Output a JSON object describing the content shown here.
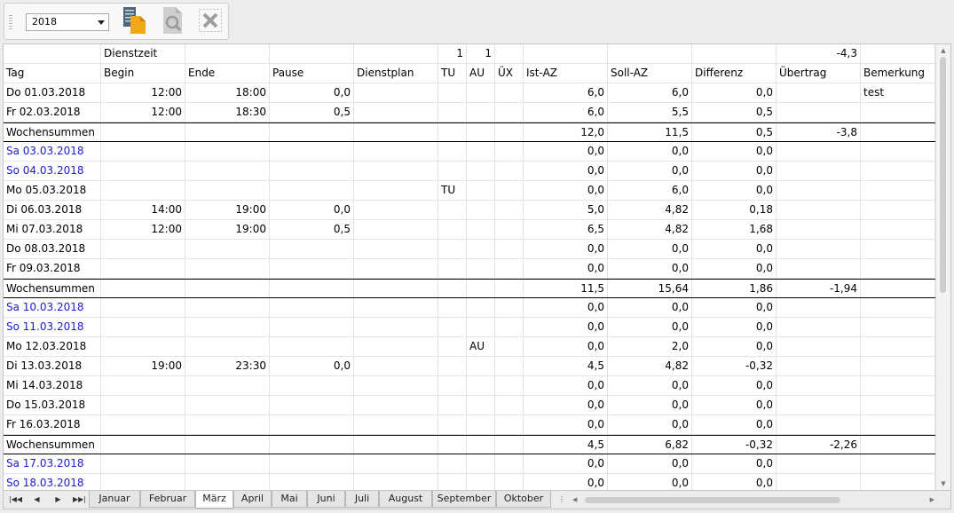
{
  "toolbar": {
    "year": "2018",
    "icons": [
      "copy-icon",
      "preview-icon",
      "delete-icon"
    ]
  },
  "grid": {
    "summary_row": {
      "label": "Dienstzeit",
      "tu": "1",
      "au": "1",
      "uebertrag": "-4,3"
    },
    "headers": [
      "Tag",
      "Begin",
      "Ende",
      "Pause",
      "Dienstplan",
      "TU",
      "AU",
      "ÜX",
      "Ist-AZ",
      "Soll-AZ",
      "Differenz",
      "Übertrag",
      "Bemerkung"
    ],
    "rows": [
      {
        "tag": "Do 01.03.2018",
        "begin": "12:00",
        "ende": "18:00",
        "pause": "0,0",
        "dienstplan": "",
        "tu": "",
        "au": "",
        "ux": "",
        "ist": "6,0",
        "soll": "6,0",
        "diff": "0,0",
        "uebertrag": "",
        "bemerkung": "test",
        "weekend": false,
        "weeksum": false
      },
      {
        "tag": "Fr 02.03.2018",
        "begin": "12:00",
        "ende": "18:30",
        "pause": "0,5",
        "dienstplan": "",
        "tu": "",
        "au": "",
        "ux": "",
        "ist": "6,0",
        "soll": "5,5",
        "diff": "0,5",
        "uebertrag": "",
        "bemerkung": "",
        "weekend": false,
        "weeksum": false
      },
      {
        "tag": "Wochensummen",
        "begin": "",
        "ende": "",
        "pause": "",
        "dienstplan": "",
        "tu": "",
        "au": "",
        "ux": "",
        "ist": "12,0",
        "soll": "11,5",
        "diff": "0,5",
        "uebertrag": "-3,8",
        "bemerkung": "",
        "weekend": false,
        "weeksum": true
      },
      {
        "tag": "Sa 03.03.2018",
        "begin": "",
        "ende": "",
        "pause": "",
        "dienstplan": "",
        "tu": "",
        "au": "",
        "ux": "",
        "ist": "0,0",
        "soll": "0,0",
        "diff": "0,0",
        "uebertrag": "",
        "bemerkung": "",
        "weekend": true,
        "weeksum": false
      },
      {
        "tag": "So 04.03.2018",
        "begin": "",
        "ende": "",
        "pause": "",
        "dienstplan": "",
        "tu": "",
        "au": "",
        "ux": "",
        "ist": "0,0",
        "soll": "0,0",
        "diff": "0,0",
        "uebertrag": "",
        "bemerkung": "",
        "weekend": true,
        "weeksum": false
      },
      {
        "tag": "Mo 05.03.2018",
        "begin": "",
        "ende": "",
        "pause": "",
        "dienstplan": "",
        "tu": "TU",
        "au": "",
        "ux": "",
        "ist": "0,0",
        "soll": "6,0",
        "diff": "0,0",
        "uebertrag": "",
        "bemerkung": "",
        "weekend": false,
        "weeksum": false
      },
      {
        "tag": "Di 06.03.2018",
        "begin": "14:00",
        "ende": "19:00",
        "pause": "0,0",
        "dienstplan": "",
        "tu": "",
        "au": "",
        "ux": "",
        "ist": "5,0",
        "soll": "4,82",
        "diff": "0,18",
        "uebertrag": "",
        "bemerkung": "",
        "weekend": false,
        "weeksum": false
      },
      {
        "tag": "Mi 07.03.2018",
        "begin": "12:00",
        "ende": "19:00",
        "pause": "0,5",
        "dienstplan": "",
        "tu": "",
        "au": "",
        "ux": "",
        "ist": "6,5",
        "soll": "4,82",
        "diff": "1,68",
        "uebertrag": "",
        "bemerkung": "",
        "weekend": false,
        "weeksum": false
      },
      {
        "tag": "Do 08.03.2018",
        "begin": "",
        "ende": "",
        "pause": "",
        "dienstplan": "",
        "tu": "",
        "au": "",
        "ux": "",
        "ist": "0,0",
        "soll": "0,0",
        "diff": "0,0",
        "uebertrag": "",
        "bemerkung": "",
        "weekend": false,
        "weeksum": false
      },
      {
        "tag": "Fr 09.03.2018",
        "begin": "",
        "ende": "",
        "pause": "",
        "dienstplan": "",
        "tu": "",
        "au": "",
        "ux": "",
        "ist": "0,0",
        "soll": "0,0",
        "diff": "0,0",
        "uebertrag": "",
        "bemerkung": "",
        "weekend": false,
        "weeksum": false
      },
      {
        "tag": "Wochensummen",
        "begin": "",
        "ende": "",
        "pause": "",
        "dienstplan": "",
        "tu": "",
        "au": "",
        "ux": "",
        "ist": "11,5",
        "soll": "15,64",
        "diff": "1,86",
        "uebertrag": "-1,94",
        "bemerkung": "",
        "weekend": false,
        "weeksum": true
      },
      {
        "tag": "Sa 10.03.2018",
        "begin": "",
        "ende": "",
        "pause": "",
        "dienstplan": "",
        "tu": "",
        "au": "",
        "ux": "",
        "ist": "0,0",
        "soll": "0,0",
        "diff": "0,0",
        "uebertrag": "",
        "bemerkung": "",
        "weekend": true,
        "weeksum": false
      },
      {
        "tag": "So 11.03.2018",
        "begin": "",
        "ende": "",
        "pause": "",
        "dienstplan": "",
        "tu": "",
        "au": "",
        "ux": "",
        "ist": "0,0",
        "soll": "0,0",
        "diff": "0,0",
        "uebertrag": "",
        "bemerkung": "",
        "weekend": true,
        "weeksum": false
      },
      {
        "tag": "Mo 12.03.2018",
        "begin": "",
        "ende": "",
        "pause": "",
        "dienstplan": "",
        "tu": "",
        "au": "AU",
        "ux": "",
        "ist": "0,0",
        "soll": "2,0",
        "diff": "0,0",
        "uebertrag": "",
        "bemerkung": "",
        "weekend": false,
        "weeksum": false
      },
      {
        "tag": "Di 13.03.2018",
        "begin": "19:00",
        "ende": "23:30",
        "pause": "0,0",
        "dienstplan": "",
        "tu": "",
        "au": "",
        "ux": "",
        "ist": "4,5",
        "soll": "4,82",
        "diff": "-0,32",
        "uebertrag": "",
        "bemerkung": "",
        "weekend": false,
        "weeksum": false
      },
      {
        "tag": "Mi 14.03.2018",
        "begin": "",
        "ende": "",
        "pause": "",
        "dienstplan": "",
        "tu": "",
        "au": "",
        "ux": "",
        "ist": "0,0",
        "soll": "0,0",
        "diff": "0,0",
        "uebertrag": "",
        "bemerkung": "",
        "weekend": false,
        "weeksum": false
      },
      {
        "tag": "Do 15.03.2018",
        "begin": "",
        "ende": "",
        "pause": "",
        "dienstplan": "",
        "tu": "",
        "au": "",
        "ux": "",
        "ist": "0,0",
        "soll": "0,0",
        "diff": "0,0",
        "uebertrag": "",
        "bemerkung": "",
        "weekend": false,
        "weeksum": false
      },
      {
        "tag": "Fr 16.03.2018",
        "begin": "",
        "ende": "",
        "pause": "",
        "dienstplan": "",
        "tu": "",
        "au": "",
        "ux": "",
        "ist": "0,0",
        "soll": "0,0",
        "diff": "0,0",
        "uebertrag": "",
        "bemerkung": "",
        "weekend": false,
        "weeksum": false
      },
      {
        "tag": "Wochensummen",
        "begin": "",
        "ende": "",
        "pause": "",
        "dienstplan": "",
        "tu": "",
        "au": "",
        "ux": "",
        "ist": "4,5",
        "soll": "6,82",
        "diff": "-0,32",
        "uebertrag": "-2,26",
        "bemerkung": "",
        "weekend": false,
        "weeksum": true
      },
      {
        "tag": "Sa 17.03.2018",
        "begin": "",
        "ende": "",
        "pause": "",
        "dienstplan": "",
        "tu": "",
        "au": "",
        "ux": "",
        "ist": "0,0",
        "soll": "0,0",
        "diff": "0,0",
        "uebertrag": "",
        "bemerkung": "",
        "weekend": true,
        "weeksum": false
      },
      {
        "tag": "So 18.03.2018",
        "begin": "",
        "ende": "",
        "pause": "",
        "dienstplan": "",
        "tu": "",
        "au": "",
        "ux": "",
        "ist": "0,0",
        "soll": "0,0",
        "diff": "0,0",
        "uebertrag": "",
        "bemerkung": "",
        "weekend": true,
        "weeksum": false
      }
    ]
  },
  "tabs": {
    "months": [
      "Januar",
      "Februar",
      "März",
      "April",
      "Mai",
      "Juni",
      "Juli",
      "August",
      "September",
      "Oktober"
    ],
    "active": "März"
  },
  "colors": {
    "weekend_text": "#1a1ad4"
  }
}
